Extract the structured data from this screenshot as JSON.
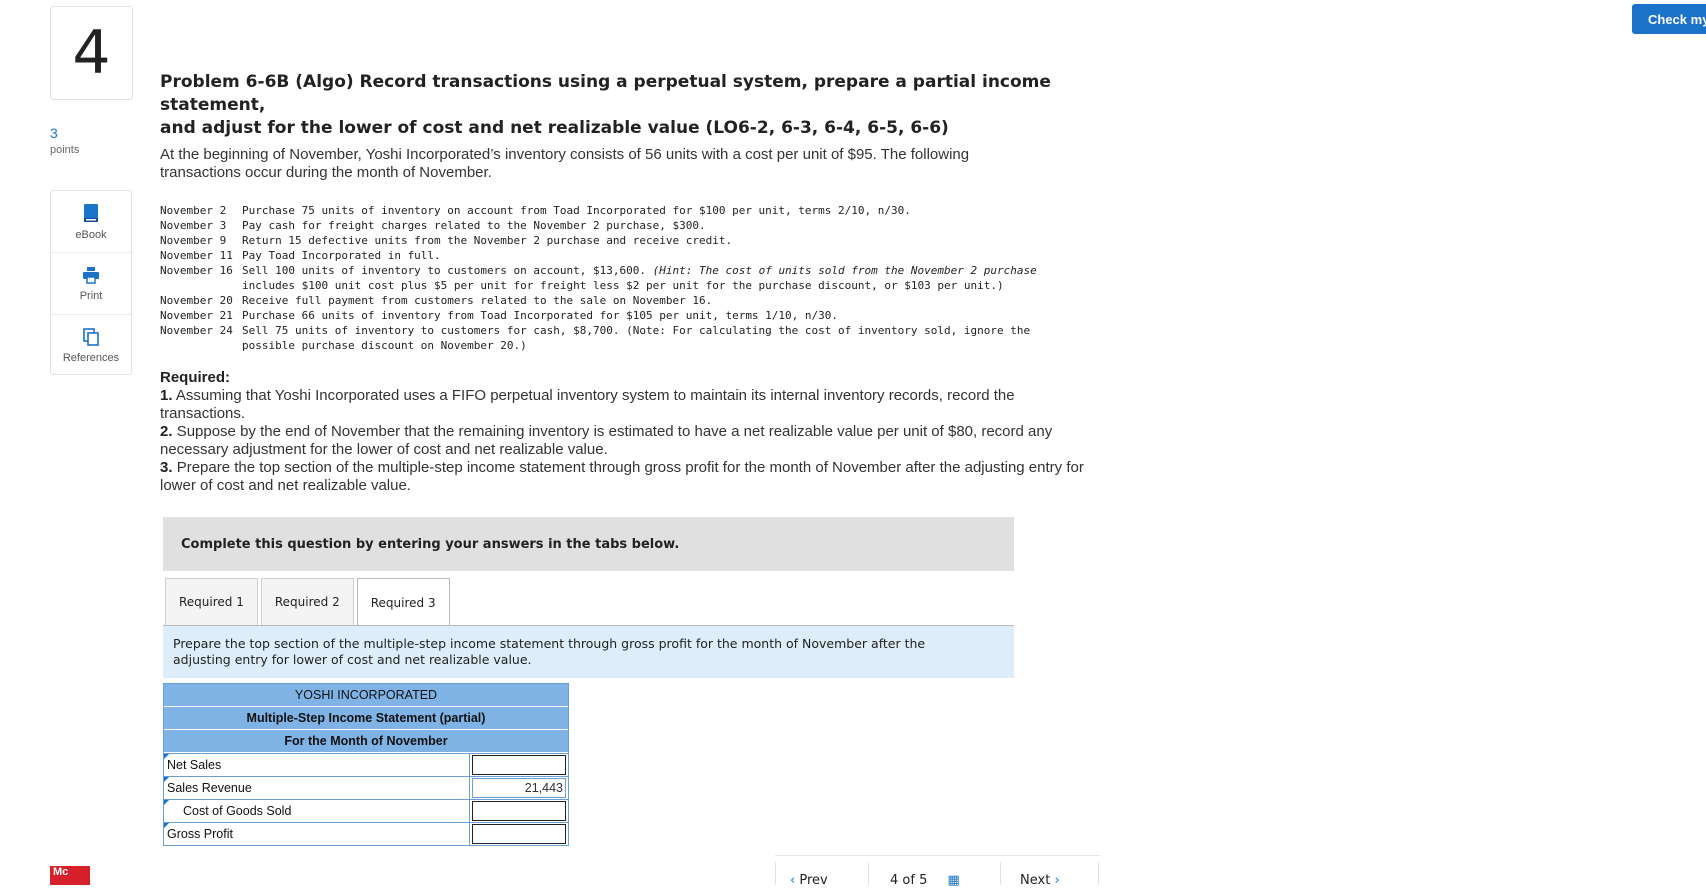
{
  "question": {
    "number": "4",
    "points_value": "3",
    "points_label": "points"
  },
  "tools": [
    {
      "label": "eBook",
      "icon": "book-icon"
    },
    {
      "label": "Print",
      "icon": "printer-icon"
    },
    {
      "label": "References",
      "icon": "copy-pages-icon"
    }
  ],
  "check_button": "Check my",
  "problem": {
    "title_line1": "Problem 6-6B (Algo) Record transactions using a perpetual system, prepare a partial income statement,",
    "title_line2": "and adjust for the lower of cost and net realizable value (LO6-2, 6-3, 6-4, 6-5, 6-6)",
    "intro": "At the beginning of November, Yoshi Incorporated’s inventory consists of 56 units with a cost per unit of $95. The following transactions occur during the month of November."
  },
  "transactions": [
    {
      "date": "November 2",
      "text": "Purchase 75 units of inventory on account from Toad Incorporated for $100 per unit, terms 2/10, n/30."
    },
    {
      "date": "November 3",
      "text": "Pay cash for freight charges related to the November 2 purchase, $300."
    },
    {
      "date": "November 9",
      "text": "Return 15 defective units from the November 2 purchase and receive credit."
    },
    {
      "date": "November 11",
      "text": "Pay Toad Incorporated in full."
    },
    {
      "date": "November 16",
      "text": "Sell 100 units of inventory to customers on account, $13,600.",
      "hint": "(Hint: The cost of units sold from the November 2 purchase",
      "hint2": "includes $100 unit cost plus $5 per unit for freight less $2 per unit for the purchase discount, or $103 per unit.)"
    },
    {
      "date": "November 20",
      "text": "Receive full payment from customers related to the sale on November 16."
    },
    {
      "date": "November 21",
      "text": "Purchase 66 units of inventory from Toad Incorporated for $105 per unit, terms 1/10, n/30."
    },
    {
      "date": "November 24",
      "text": "Sell 75 units of inventory to customers for cash, $8,700. (Note: For calculating the cost of inventory sold, ignore the",
      "text2": "possible purchase discount on November 20.)"
    }
  ],
  "required": {
    "heading": "Required:",
    "items": [
      {
        "num": "1.",
        "text": "Assuming that Yoshi Incorporated uses a FIFO perpetual inventory system to maintain its internal inventory records, record the transactions."
      },
      {
        "num": "2.",
        "text": "Suppose by the end of November that the remaining inventory is estimated to have a net realizable value per unit of $80, record any necessary adjustment for the lower of cost and net realizable value."
      },
      {
        "num": "3.",
        "text": "Prepare the top section of the multiple-step income statement through gross profit for the month of November after the adjusting entry for lower of cost and net realizable value."
      }
    ]
  },
  "instructions": "Complete this question by entering your answers in the tabs below.",
  "tabs": [
    "Required 1",
    "Required 2",
    "Required 3"
  ],
  "active_tab": "Required 3",
  "tab_prompt": "Prepare the top section of the multiple-step income statement through gross profit for the month of November after the adjusting entry for lower of cost and net realizable value.",
  "statement": {
    "company": "YOSHI INCORPORATED",
    "title": "Multiple-Step Income Statement (partial)",
    "period": "For the Month of November",
    "rows": [
      {
        "label": "Net Sales",
        "value": ""
      },
      {
        "label": "Sales Revenue",
        "value": "21,443"
      },
      {
        "label": "Cost of Goods Sold",
        "value": ""
      },
      {
        "label": "Gross Profit",
        "value": ""
      }
    ]
  },
  "footer": {
    "logo": "Mc",
    "prev": "Prev",
    "page_current": "4",
    "page_of": "of",
    "page_total": "5",
    "next": "Next"
  }
}
